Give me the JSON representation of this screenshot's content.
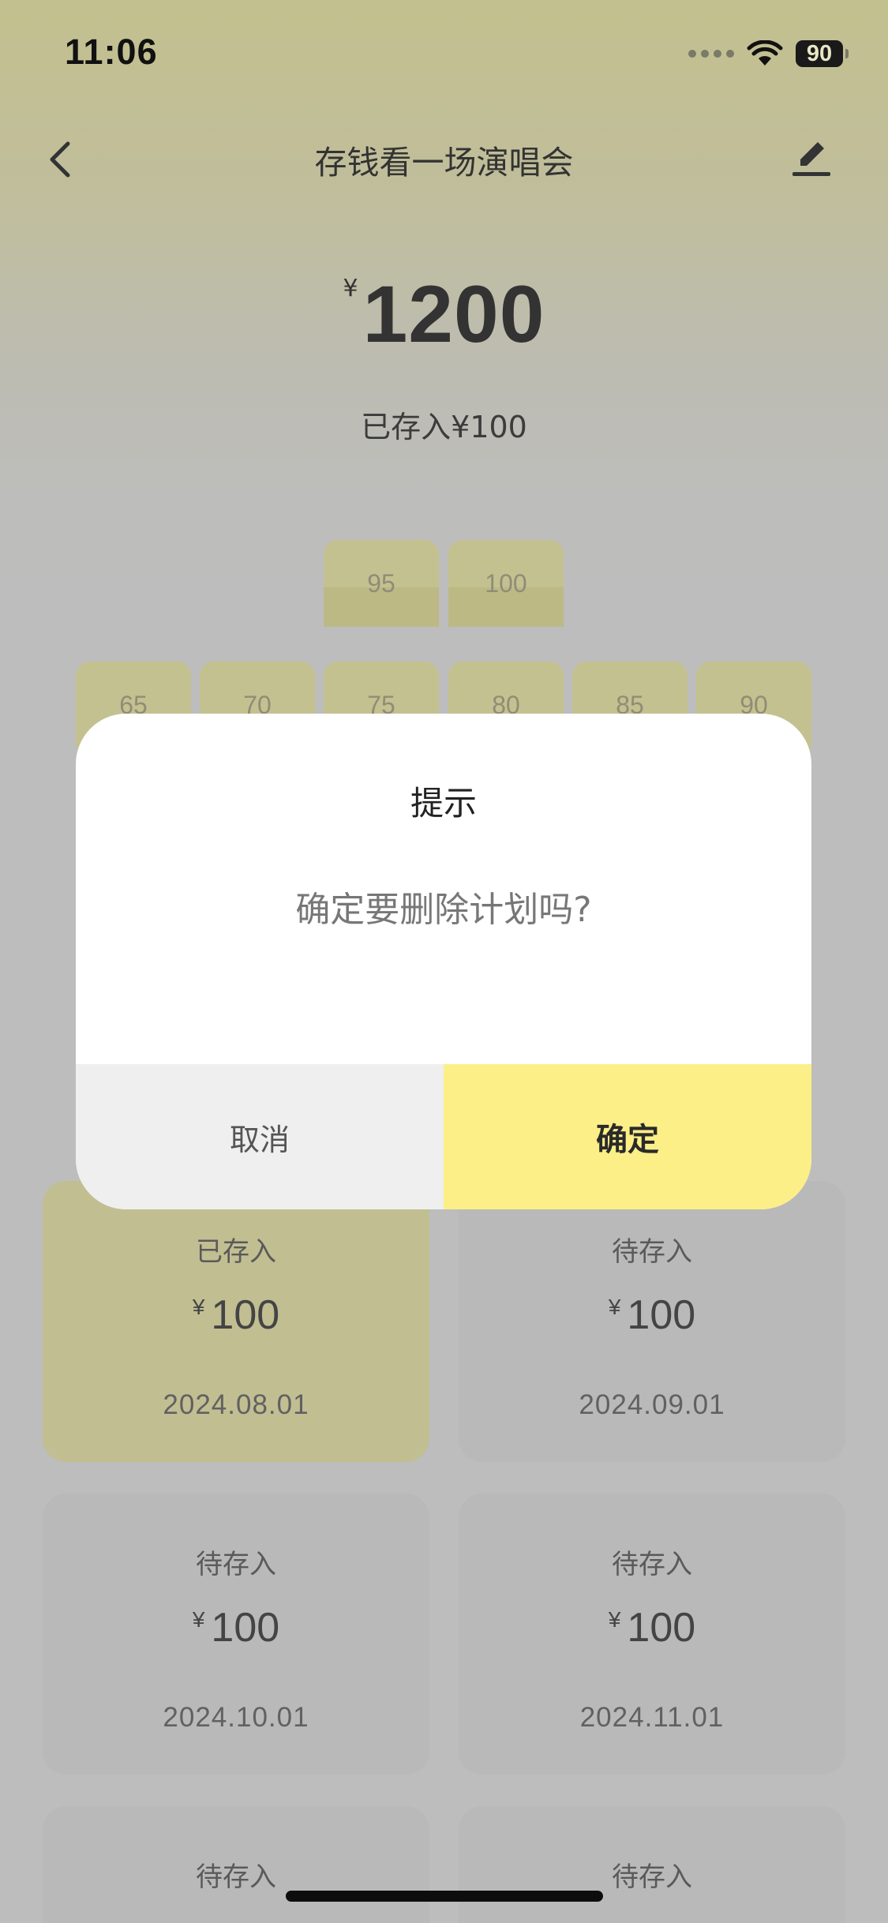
{
  "status_bar": {
    "time": "11:06",
    "battery": "90"
  },
  "nav": {
    "title": "存钱看一场演唱会",
    "back_icon": "chevron-left-icon",
    "edit_icon": "edit-pencil-icon"
  },
  "summary": {
    "currency": "¥",
    "target_amount": "1200",
    "saved_text": "已存入¥100"
  },
  "grid_cells": [
    "95",
    "100",
    "65",
    "70",
    "75",
    "80",
    "85",
    "90"
  ],
  "dialog": {
    "title": "提示",
    "message": "确定要删除计划吗?",
    "cancel_label": "取消",
    "confirm_label": "确定"
  },
  "cards": [
    {
      "status": "已存入",
      "currency": "¥",
      "amount": "100",
      "date": "2024.08.01"
    },
    {
      "status": "待存入",
      "currency": "¥",
      "amount": "100",
      "date": "2024.09.01"
    },
    {
      "status": "待存入",
      "currency": "¥",
      "amount": "100",
      "date": "2024.10.01"
    },
    {
      "status": "待存入",
      "currency": "¥",
      "amount": "100",
      "date": "2024.11.01"
    },
    {
      "status": "待存入",
      "currency": "¥",
      "amount": "",
      "date": ""
    },
    {
      "status": "待存入",
      "currency": "¥",
      "amount": "",
      "date": ""
    }
  ],
  "colors": {
    "accent": "#fcef88",
    "saved_card": "#c1be92",
    "pending_card": "#b9b9b9"
  }
}
